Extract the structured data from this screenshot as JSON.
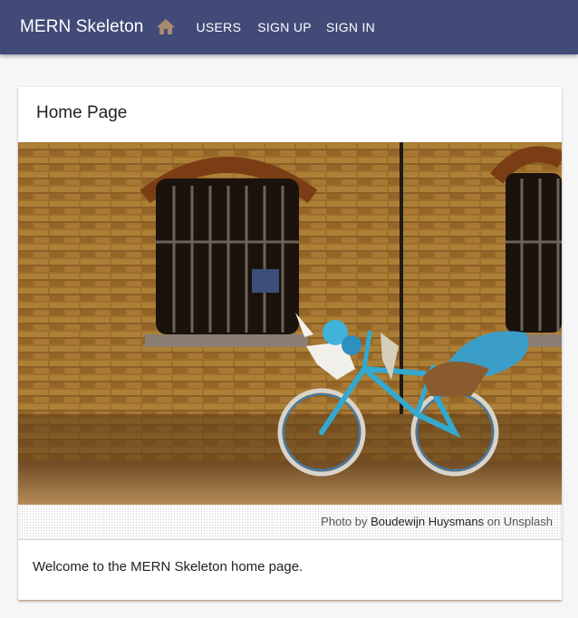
{
  "appbar": {
    "title": "MERN Skeleton",
    "home_icon": "home-icon",
    "nav": {
      "users": "USERS",
      "signup": "SIGN UP",
      "signin": "SIGN IN"
    },
    "colors": {
      "bar": "#424b78",
      "home_icon": "#a88a6e"
    }
  },
  "card": {
    "title": "Home Page",
    "caption": {
      "prefix": "Photo by ",
      "author": "Boudewijn Huysmans",
      "middle": " on ",
      "site": "Unsplash"
    },
    "body_text": "Welcome to the MERN Skeleton home page."
  }
}
